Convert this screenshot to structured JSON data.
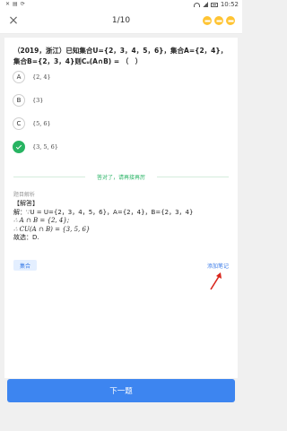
{
  "status_bar": {
    "left_icons": [
      "app-icon",
      "notification-icon",
      "sync-icon"
    ],
    "time": "10:52"
  },
  "header": {
    "close_symbol": "×",
    "counter": "1/10",
    "dots_color": "#ffc433"
  },
  "question": {
    "text": "（2019，浙江）已知集合U={2，3，4，5，6}，集合A={2，4}，集合B={2，3，4}则Cᵤ(A∩B) = （　）"
  },
  "options": [
    {
      "letter": "A",
      "text": "{2, 4}",
      "state": "normal"
    },
    {
      "letter": "B",
      "text": "{3}",
      "state": "normal"
    },
    {
      "letter": "C",
      "text": "{5, 6}",
      "state": "normal"
    },
    {
      "letter": "",
      "text": "{3, 5, 6}",
      "state": "correct"
    }
  ],
  "feedback": "答对了，请再接再厉",
  "analysis": {
    "title": "题目解析",
    "lines": [
      "【解答】",
      "解：∵U = U={2，3，4，5，6}，A={2，4}，B={2，3，4}",
      "∴ A ∩ B = {2, 4};",
      "∴ CU(A ∩ B) = {3, 5, 6}",
      "故选：D."
    ]
  },
  "tag": "集合",
  "add_note": "添加笔记",
  "next_button": "下一题",
  "colors": {
    "accent": "#3d85f0",
    "correct": "#28b462",
    "arrow": "#d9261c"
  }
}
